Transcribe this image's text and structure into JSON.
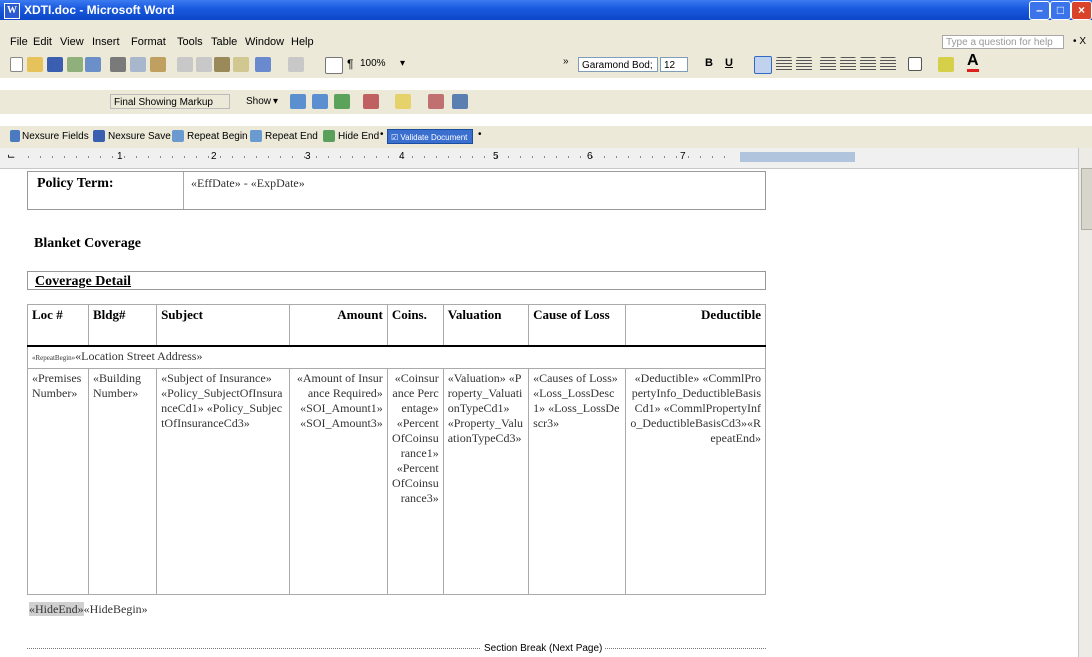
{
  "window": {
    "title": "XDTI.doc - Microsoft Word"
  },
  "menu": [
    "File",
    "Edit",
    "View",
    "Insert",
    "Format",
    "Tools",
    "Table",
    "Window",
    "Help"
  ],
  "help_placeholder": "Type a question for help",
  "formatting": {
    "zoom": "100%",
    "font": "Garamond Bod;",
    "size": "12",
    "bold": "B",
    "underline": "U"
  },
  "reviewing": {
    "markup": "Final Showing Markup",
    "show": "Show"
  },
  "nexsure_toolbar": {
    "fields": "Nexsure Fields",
    "save": "Nexsure Save",
    "repeat_begin": "Repeat Begin",
    "repeat_end": "Repeat End",
    "hide_end": "Hide End",
    "validate": "Validate Document"
  },
  "ruler_numbers": [
    "1",
    "2",
    "3",
    "4",
    "5",
    "6",
    "7"
  ],
  "document": {
    "policy_term_label": "Policy Term:",
    "policy_term_value": "«EffDate» - «ExpDate»",
    "blanket_heading": "Blanket Coverage",
    "coverage_detail_heading": "Coverage Detail",
    "headers": [
      "Loc #",
      "Bldg#",
      "Subject",
      "Amount",
      "Coins.",
      "Valuation",
      "Cause of Loss",
      "Deductible"
    ],
    "repeat_begin_tag": "«RepeatBegin»",
    "location_row": "«Location Street Address»",
    "cells": [
      "«Premises Number»",
      "«Building Number»",
      "«Subject of Insurance» «Policy_SubjectOfInsuranceCd1» «Policy_SubjectOfInsuranceCd3»",
      "«Amount of Insurance Required» «SOI_Amount1» «SOI_Amount3»",
      "«Coinsurance Percentage» «PercentOfCoinsurance1» «PercentOfCoinsurance3»",
      "«Valuation» «Property_ValuationTypeCd1» «Property_ValuationTypeCd3»",
      "«Causes of Loss» «Loss_LossDesc1» «Loss_LossDescr3»",
      "«Deductible» «CommlPropertyInfo_DeductibleBasisCd1» «CommlPropertyInfo_DeductibleBasisCd3»«RepeatEnd»"
    ],
    "hide_end": "«HideEnd»",
    "hide_begin": "«HideBegin»",
    "section_break": "Section Break (Next Page)"
  },
  "colors": {
    "titlebar": "#0b46c7",
    "chrome": "#ece9d8",
    "close": "#d9432a"
  }
}
